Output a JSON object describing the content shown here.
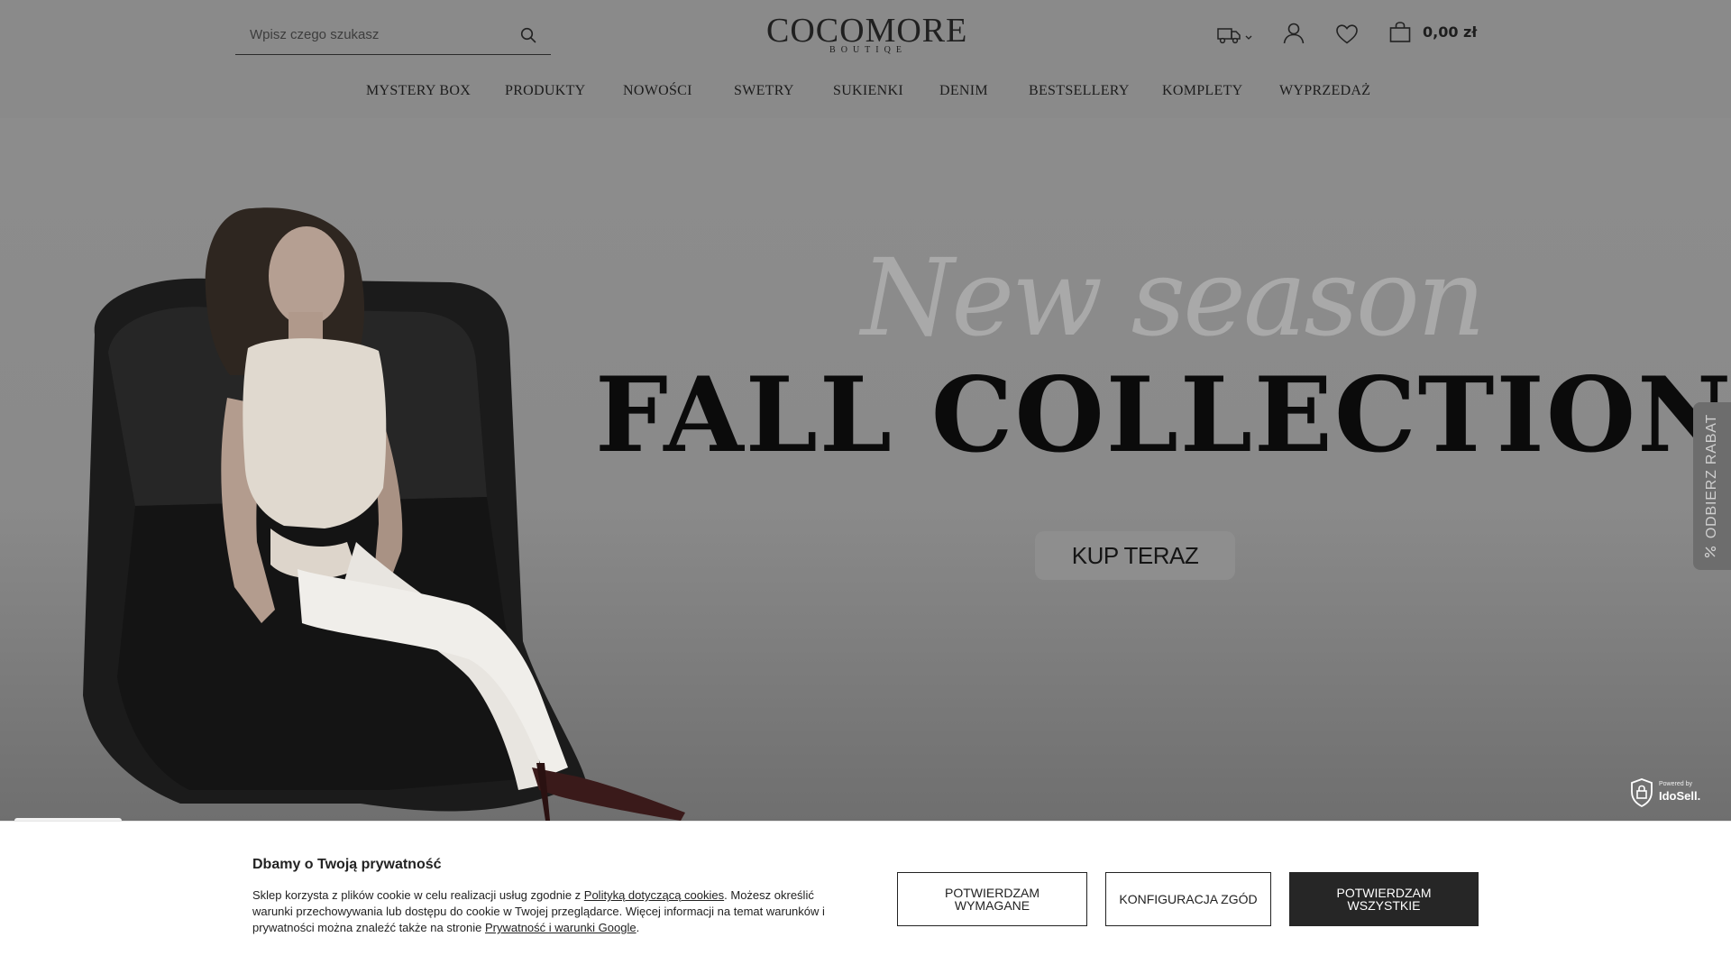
{
  "header": {
    "search_placeholder": "Wpisz czego szukasz",
    "logo_main": "COCOMORE",
    "logo_sub": "BOUTIQE",
    "cart_total": "0,00 zł",
    "icons": [
      "search-icon",
      "delivery-truck-icon",
      "chevron-down-icon",
      "user-icon",
      "heart-icon",
      "shopping-bag-icon"
    ]
  },
  "nav": {
    "items": [
      {
        "label": "MYSTERY BOX"
      },
      {
        "label": "PRODUKTY"
      },
      {
        "label": "NOWOŚCI"
      },
      {
        "label": "SWETRY"
      },
      {
        "label": "SUKIENKI"
      },
      {
        "label": "DENIM"
      },
      {
        "label": "BESTSELLERY"
      },
      {
        "label": "KOMPLETY"
      },
      {
        "label": "WYPRZEDAŻ"
      }
    ]
  },
  "hero": {
    "script_title": "New season",
    "main_title": "FALL COLLECTION",
    "cta_label": "KUP TERAZ"
  },
  "side_tab": {
    "label": "ODBIERZ RABAT"
  },
  "badge": {
    "powered_by": "Powered by",
    "brand": "IdoSell."
  },
  "cookie": {
    "title": "Dbamy o Twoją prywatność",
    "text_1": "Sklep korzysta z plików cookie w celu realizacji usług zgodnie z ",
    "link_1": "Polityką dotyczącą cookies",
    "text_2": ". Możesz określić warunki przechowywania lub dostępu do cookie w Twojej przeglądarce. Więcej informacji na temat warunków i prywatności można znaleźć także na stronie ",
    "link_2": "Prywatność i warunki Google",
    "text_3": ".",
    "buttons": {
      "required": "POTWIERDZAM WYMAGANE",
      "configure": "KONFIGURACJA ZGÓD",
      "all": "POTWIERDZAM WSZYSTKIE"
    }
  },
  "colors": {
    "overlay_gray": "#8a8a8a",
    "text_dark": "#1c1c1c",
    "cookie_solid_button": "#262626"
  }
}
